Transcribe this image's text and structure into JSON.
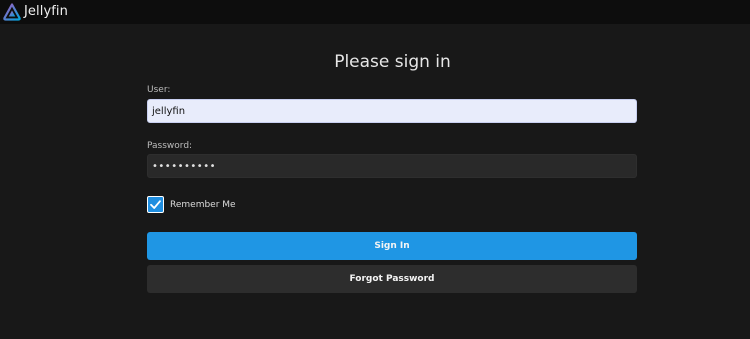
{
  "header": {
    "logo_text": "Jellyfin",
    "logo_icon": "jellyfin-logo-icon"
  },
  "login": {
    "title": "Please sign in",
    "user_label": "User:",
    "user_value": "jellyfin",
    "password_label": "Password:",
    "password_mask": "••••••••••",
    "remember_label": "Remember Me",
    "remember_checked": true,
    "signin_label": "Sign In",
    "forgot_label": "Forgot Password"
  },
  "colors": {
    "accent": "#00a4dc",
    "signin_button": "#1f96e4",
    "logo_purple": "#aa5cc3",
    "background": "#181818"
  }
}
